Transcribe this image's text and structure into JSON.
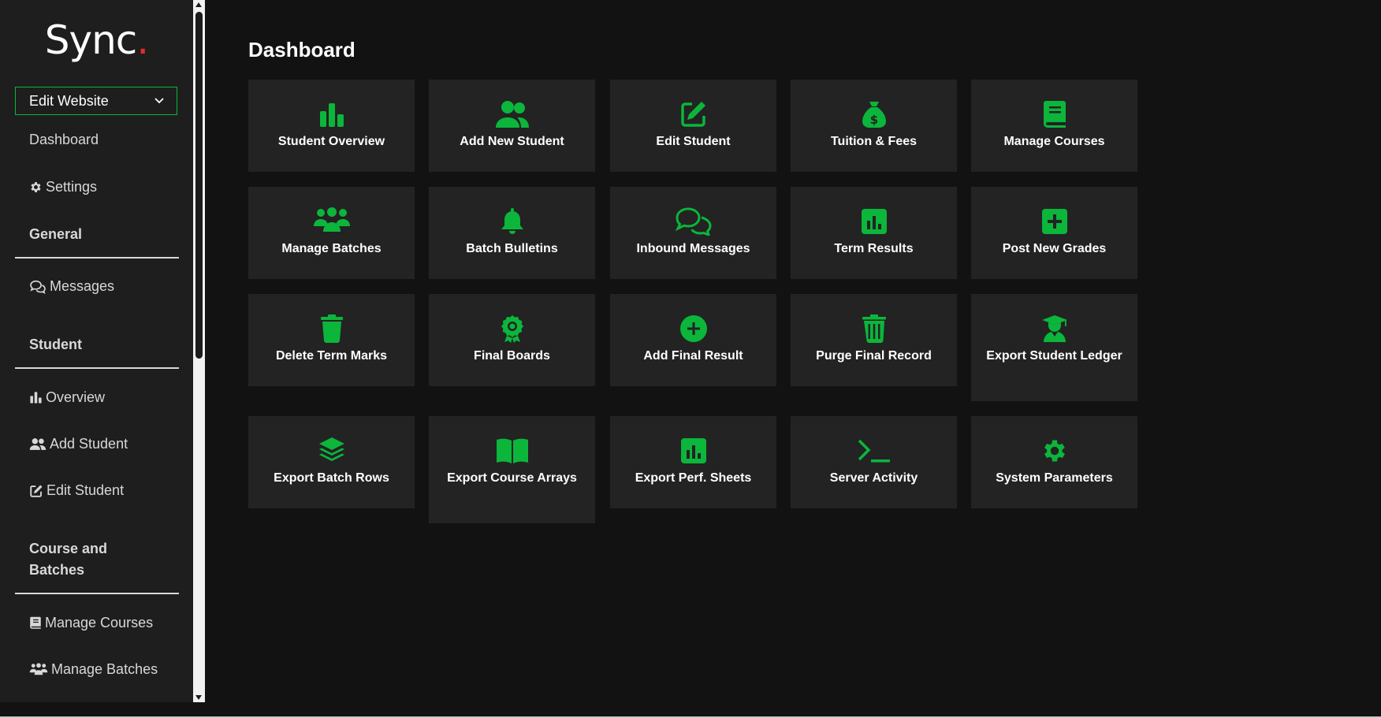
{
  "app": {
    "logo_text": "Sync",
    "logo_dot": ".",
    "accent_color": "#0bb63b",
    "logo_dot_color": "#e22b2b"
  },
  "sidebar": {
    "dropdown_label": "Edit Website",
    "top_links": [
      {
        "label": "Dashboard",
        "icon": "none"
      },
      {
        "label": "Settings",
        "icon": "gear-icon"
      }
    ],
    "sections": [
      {
        "heading": "General",
        "items": [
          {
            "label": "Messages",
            "icon": "chat-icon"
          }
        ]
      },
      {
        "heading": "Student",
        "items": [
          {
            "label": "Overview",
            "icon": "bar-chart-icon"
          },
          {
            "label": "Add Student",
            "icon": "users-icon"
          },
          {
            "label": "Edit Student",
            "icon": "edit-icon"
          }
        ]
      },
      {
        "heading_line1": "Course and",
        "heading_line2": "Batches",
        "items": [
          {
            "label": "Manage Courses",
            "icon": "book-icon"
          },
          {
            "label": "Manage Batches",
            "icon": "group-icon"
          }
        ]
      }
    ]
  },
  "main": {
    "title": "Dashboard",
    "tiles": [
      {
        "label": "Student Overview",
        "icon": "bar-chart-icon"
      },
      {
        "label": "Add New Student",
        "icon": "users-icon"
      },
      {
        "label": "Edit Student",
        "icon": "edit-icon"
      },
      {
        "label": "Tuition & Fees",
        "icon": "money-bag-icon"
      },
      {
        "label": "Manage Courses",
        "icon": "book-icon"
      },
      {
        "label": "Manage Batches",
        "icon": "group-icon"
      },
      {
        "label": "Batch Bulletins",
        "icon": "bell-icon"
      },
      {
        "label": "Inbound Messages",
        "icon": "chat-icon"
      },
      {
        "label": "Term Results",
        "icon": "square-chart-icon"
      },
      {
        "label": "Post New Grades",
        "icon": "plus-square-icon"
      },
      {
        "label": "Delete Term Marks",
        "icon": "trash-icon"
      },
      {
        "label": "Final Boards",
        "icon": "award-icon"
      },
      {
        "label": "Add Final Result",
        "icon": "plus-circle-icon"
      },
      {
        "label": "Purge Final Record",
        "icon": "trash-lines-icon"
      },
      {
        "label": "Export Student Ledger",
        "icon": "graduate-icon"
      },
      {
        "label": "Export Batch Rows",
        "icon": "layers-icon"
      },
      {
        "label": "Export Course Arrays",
        "icon": "open-book-icon"
      },
      {
        "label": "Export Perf. Sheets",
        "icon": "square-chart-icon"
      },
      {
        "label": "Server Activity",
        "icon": "terminal-icon"
      },
      {
        "label": "System Parameters",
        "icon": "gear-icon"
      }
    ]
  }
}
